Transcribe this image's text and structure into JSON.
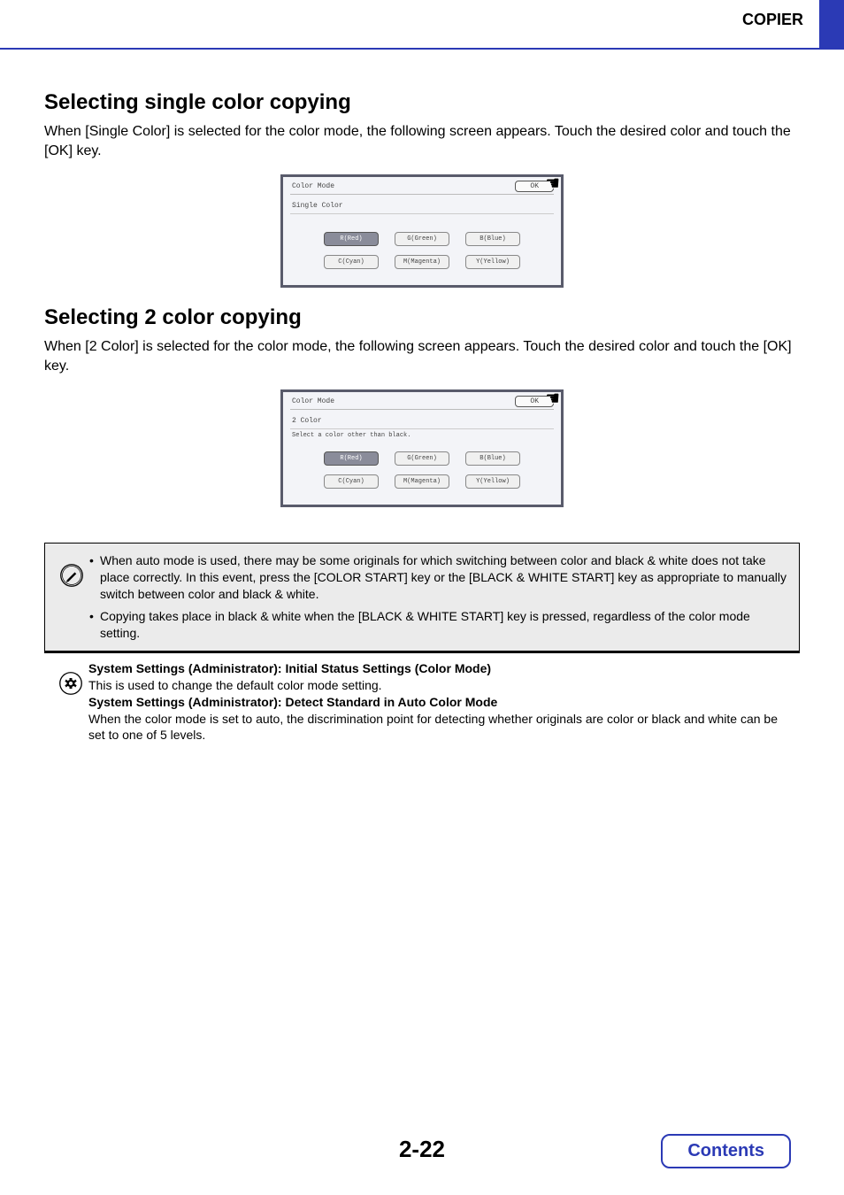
{
  "header": {
    "category": "COPIER"
  },
  "section1": {
    "heading": "Selecting single color copying",
    "paragraph": "When [Single Color] is selected for the color mode, the following screen appears. Touch the desired color and touch the [OK] key."
  },
  "section2": {
    "heading": "Selecting 2 color copying",
    "paragraph": "When [2 Color] is selected for the color mode, the following screen appears. Touch the desired color and touch the [OK] key."
  },
  "panel1": {
    "title": "Color Mode",
    "ok": "OK",
    "sub": "Single Color",
    "buttons_row1": [
      "R(Red)",
      "G(Green)",
      "B(Blue)"
    ],
    "buttons_row2": [
      "C(Cyan)",
      "M(Magenta)",
      "Y(Yellow)"
    ]
  },
  "panel2": {
    "title": "Color Mode",
    "ok": "OK",
    "sub": "2 Color",
    "instruction": "Select a color other than black.",
    "buttons_row1": [
      "R(Red)",
      "G(Green)",
      "B(Blue)"
    ],
    "buttons_row2": [
      "C(Cyan)",
      "M(Magenta)",
      "Y(Yellow)"
    ]
  },
  "note": {
    "item1": "When auto mode is used, there may be some originals for which switching between color and black & white does not take place correctly. In this event, press the [COLOR START] key or the [BLACK & WHITE START] key as appropriate to manually switch between color and black & white.",
    "item2": "Copying takes place in black & white when the [BLACK & WHITE START] key is pressed, regardless of the color mode setting."
  },
  "admin": {
    "line1_bold": "System Settings (Administrator): Initial Status Settings (Color Mode)",
    "line1_text": "This is used to change the default color mode setting.",
    "line2_bold": "System Settings (Administrator): Detect Standard in Auto Color Mode",
    "line2_text": "When the color mode is set to auto, the discrimination point for detecting whether originals are color or black and white can be set to one of 5 levels."
  },
  "page_number": "2-22",
  "contents_label": "Contents"
}
